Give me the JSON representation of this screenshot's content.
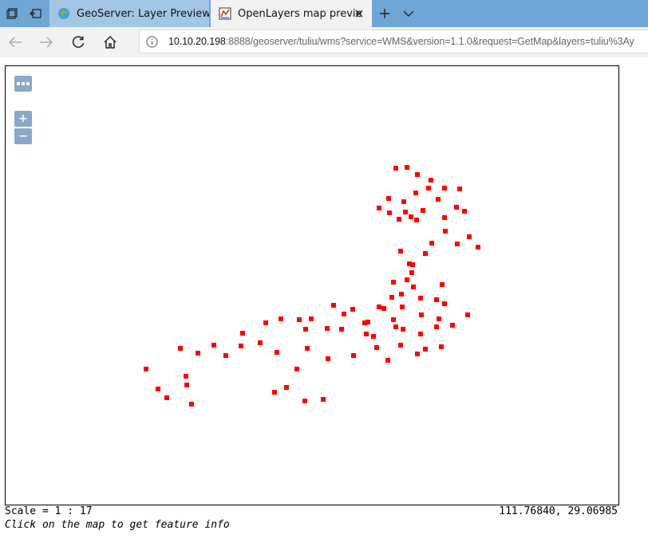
{
  "tabs": [
    {
      "title": "GeoServer: Layer Preview",
      "active": false,
      "icon": "geoserver-globe-icon"
    },
    {
      "title": "OpenLayers map previe",
      "active": true,
      "icon": "openlayers-icon"
    }
  ],
  "address": {
    "host": "10.10.20.198",
    "rest": ":8888/geoserver/tuliu/wms?service=WMS&version=1.1.0&request=GetMap&layers=tuliu%3Ay"
  },
  "map": {
    "point_color": "#ff0000",
    "toolbar_button": "...",
    "zoom_in_label": "+",
    "zoom_out_label": "−"
  },
  "footer": {
    "scale": "Scale = 1 : 17",
    "coordinates": "111.76840, 29.06985",
    "hint": "Click on the map to get feature info"
  },
  "colors": {
    "tabbar": "#6fa6d6",
    "toolbar": "#f2f2f2",
    "ol_control": "#7c99c3"
  }
}
